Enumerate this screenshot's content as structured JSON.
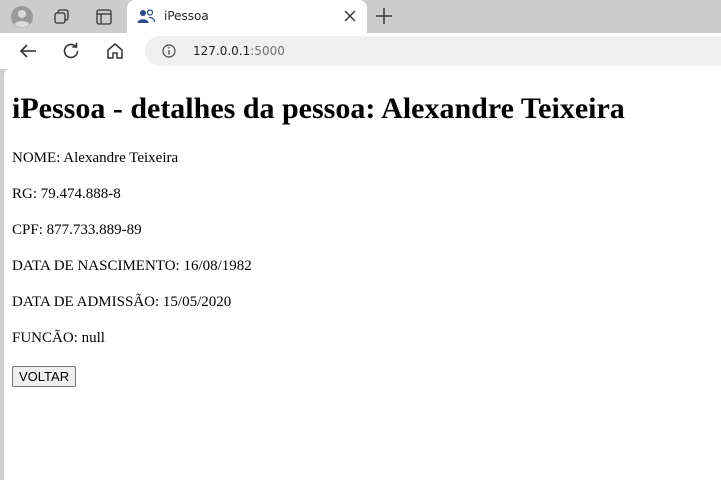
{
  "browser": {
    "tab_title": "iPessoa",
    "url_host": "127.0.0.1",
    "url_port": ":5000"
  },
  "page": {
    "heading": "iPessoa - detalhes da pessoa: Alexandre Teixeira",
    "fields": [
      {
        "label": "NOME:",
        "value": "Alexandre Teixeira"
      },
      {
        "label": "RG:",
        "value": "79.474.888-8"
      },
      {
        "label": "CPF:",
        "value": "877.733.889-89"
      },
      {
        "label": "DATA DE NASCIMENTO:",
        "value": "16/08/1982"
      },
      {
        "label": "DATA DE ADMISSÃO:",
        "value": "15/05/2020"
      },
      {
        "label": "FUNCÃO:",
        "value": "null"
      }
    ],
    "back_button_label": "VOLTAR"
  }
}
